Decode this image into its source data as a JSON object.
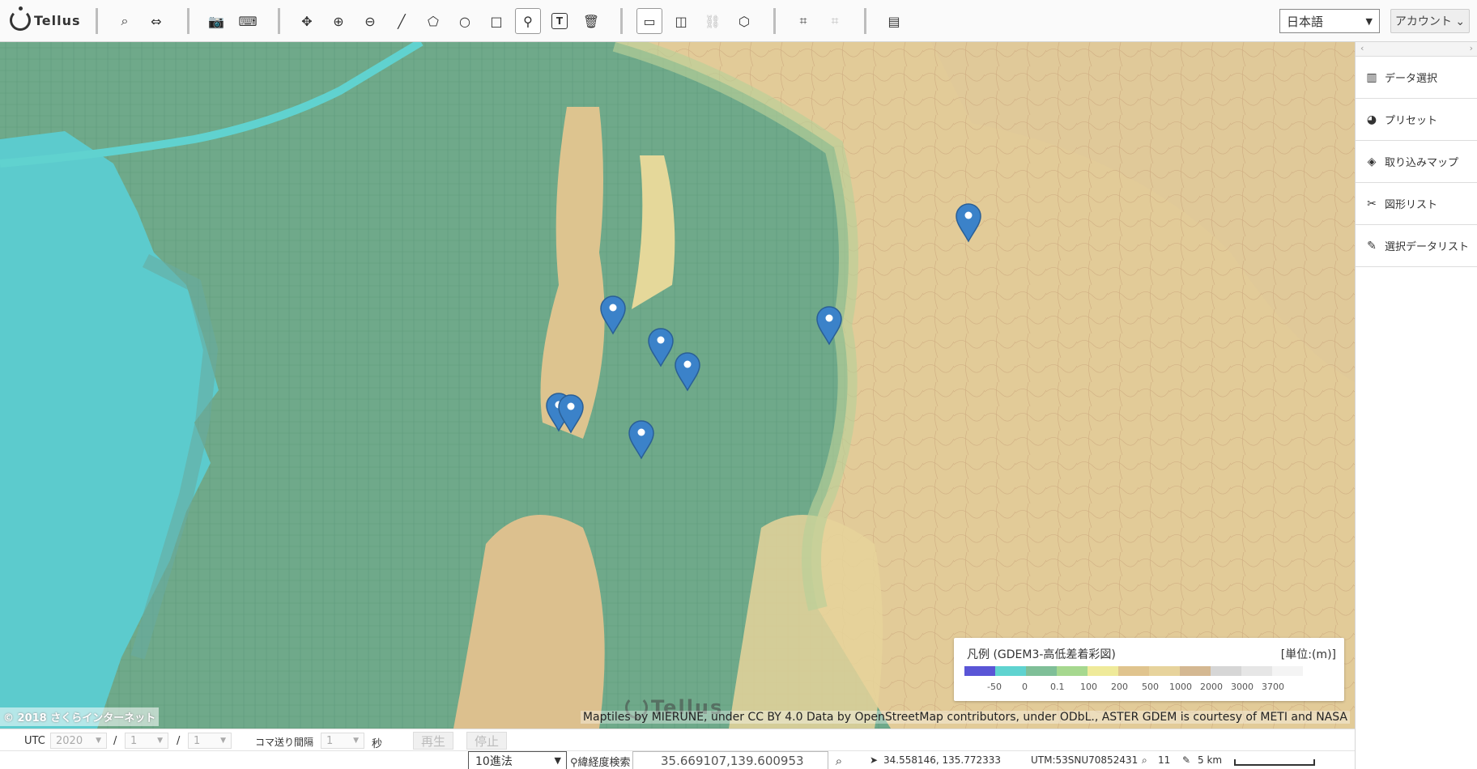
{
  "app": {
    "logo_text": "Tellus"
  },
  "toolbar": {
    "buttons": [
      {
        "name": "search",
        "icon": "search-icon",
        "glyph": "⌕"
      },
      {
        "name": "compare",
        "icon": "swap-icon",
        "glyph": "⇔"
      },
      {
        "name": "screenshot",
        "icon": "camera-icon",
        "glyph": "📷"
      },
      {
        "name": "keyboard",
        "icon": "keyboard-icon",
        "glyph": "⌨"
      },
      {
        "name": "pan",
        "icon": "move-icon",
        "glyph": "✥"
      },
      {
        "name": "zoom-in",
        "icon": "zoom-in-icon",
        "glyph": "⊕"
      },
      {
        "name": "zoom-out",
        "icon": "zoom-out-icon",
        "glyph": "⊖"
      },
      {
        "name": "draw-line",
        "icon": "line-icon",
        "glyph": "╱"
      },
      {
        "name": "draw-polygon",
        "icon": "lasso-icon",
        "glyph": "⬠"
      },
      {
        "name": "draw-circle",
        "icon": "circle-icon",
        "glyph": "○"
      },
      {
        "name": "draw-rect",
        "icon": "square-icon",
        "glyph": "□"
      },
      {
        "name": "draw-marker",
        "icon": "map-pin-icon",
        "glyph": "⚲"
      },
      {
        "name": "draw-text",
        "icon": "text-icon",
        "glyph": "T"
      },
      {
        "name": "delete",
        "icon": "trash-icon",
        "glyph": "🗑"
      },
      {
        "name": "single-view",
        "icon": "window-icon",
        "glyph": "▭"
      },
      {
        "name": "split-view",
        "icon": "split-window-icon",
        "glyph": "◫"
      },
      {
        "name": "link-view",
        "icon": "link-icon",
        "glyph": "⛓"
      },
      {
        "name": "3d-view",
        "icon": "cube-icon",
        "glyph": "⬡"
      },
      {
        "name": "crop",
        "icon": "crop-icon",
        "glyph": "⌗"
      },
      {
        "name": "crop-clear",
        "icon": "crop-off-icon",
        "glyph": "⌗"
      },
      {
        "name": "notes",
        "icon": "document-icon",
        "glyph": "▤"
      }
    ],
    "language": "日本語",
    "account": "アカウント ⌄"
  },
  "map": {
    "copyright": "© 2018 さくらインターネット",
    "attribution": "Maptiles by MIERUNE, under CC BY 4.0 Data by OpenStreetMap contributors, under ODbL., ASTER GDEM is courtesy of METI and NASA",
    "watermark": "Tellus",
    "marker_color": "#3b82c9",
    "legend": {
      "title": "凡例 (GDEM3-高低差着彩図)",
      "unit": "[単位:(m)]",
      "colors": [
        "#5a55d6",
        "#5fd3d0",
        "#7fbf98",
        "#a6d88f",
        "#efea9a",
        "#e0c48e",
        "#e7d39c",
        "#d4b892",
        "#d6d6d6",
        "#e6e6e6",
        "#f4f4f4"
      ],
      "labels": [
        "-50",
        "0",
        "0.1",
        "100",
        "200",
        "500",
        "1000",
        "2000",
        "3000",
        "3700"
      ]
    }
  },
  "panel": {
    "items": [
      {
        "label": "データ選択",
        "icon": "map-book-icon",
        "glyph": "▥"
      },
      {
        "label": "プリセット",
        "icon": "palette-icon",
        "glyph": "◕"
      },
      {
        "label": "取り込みマップ",
        "icon": "layers-icon",
        "glyph": "◈"
      },
      {
        "label": "図形リスト",
        "icon": "tools-icon",
        "glyph": "✂"
      },
      {
        "label": "選択データリスト",
        "icon": "pin-icon",
        "glyph": "✎"
      }
    ]
  },
  "timebar": {
    "utc_label": "UTC",
    "year": "2020",
    "month": "1",
    "day": "1",
    "sep": "/",
    "interval_label": "コマ送り間隔",
    "interval": "1",
    "unit": "秒",
    "play": "再生",
    "stop": "停止"
  },
  "statusbar": {
    "coord_mode": "10進法",
    "search_label": "⚲緯経度検索",
    "coord_value": "35.669107,139.600953",
    "cursor_coords": "34.558146, 135.772333",
    "utm": "UTM:53SNU70852431",
    "zoom": "11",
    "scale": "5 km"
  }
}
